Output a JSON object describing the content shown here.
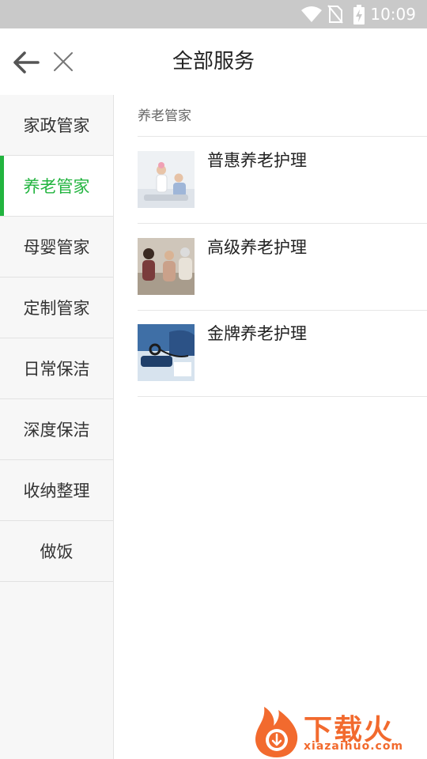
{
  "status_bar": {
    "time": "10:09"
  },
  "header": {
    "title": "全部服务"
  },
  "sidebar": {
    "items": [
      {
        "label": "家政管家"
      },
      {
        "label": "养老管家"
      },
      {
        "label": "母婴管家"
      },
      {
        "label": "定制管家"
      },
      {
        "label": "日常保洁"
      },
      {
        "label": "深度保洁"
      },
      {
        "label": "收纳整理"
      },
      {
        "label": "做饭"
      }
    ]
  },
  "content": {
    "section_title": "养老管家",
    "services": [
      {
        "name": "普惠养老护理"
      },
      {
        "name": "高级养老护理"
      },
      {
        "name": "金牌养老护理"
      }
    ]
  },
  "watermark": {
    "brand": "下载火",
    "domain": "xiazaihuo.com"
  },
  "colors": {
    "accent": "#22b43f",
    "watermark": "#f26a2e"
  }
}
